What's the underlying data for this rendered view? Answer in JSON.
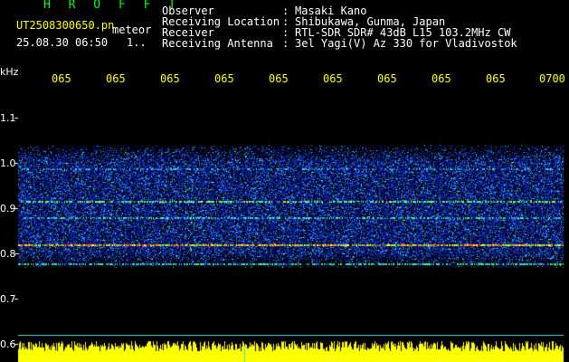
{
  "app": {
    "logo": "H R O F F T",
    "filename": "UT2508300650.pn",
    "tag": "meteor",
    "datetime": "25.08.30 06:50",
    "page": "1.."
  },
  "info": [
    {
      "label": "Observer",
      "value": "Masaki Kano"
    },
    {
      "label": "Receiving Location",
      "value": "Shibukawa, Gunma, Japan"
    },
    {
      "label": "Receiver",
      "value": "RTL-SDR SDR# 43dB L15 103.2MHz CW"
    },
    {
      "label": "Receiving Antenna",
      "value": "3el Yagi(V) Az 330 for Vladivostok"
    }
  ],
  "axis": {
    "unit": "kHz",
    "y_ticks": [
      "1.1",
      "1.0",
      "0.9",
      "0.8",
      "0.7",
      "0.6"
    ],
    "time_ticks": [
      "065",
      "065",
      "065",
      "065",
      "065",
      "065",
      "065",
      "065",
      "065",
      "0700"
    ]
  },
  "colors": {
    "background": "#000000",
    "text": "#ffffff",
    "ticks": "#ffff00",
    "logo": "#00ff00",
    "noise_floor": "#ffff00"
  }
}
